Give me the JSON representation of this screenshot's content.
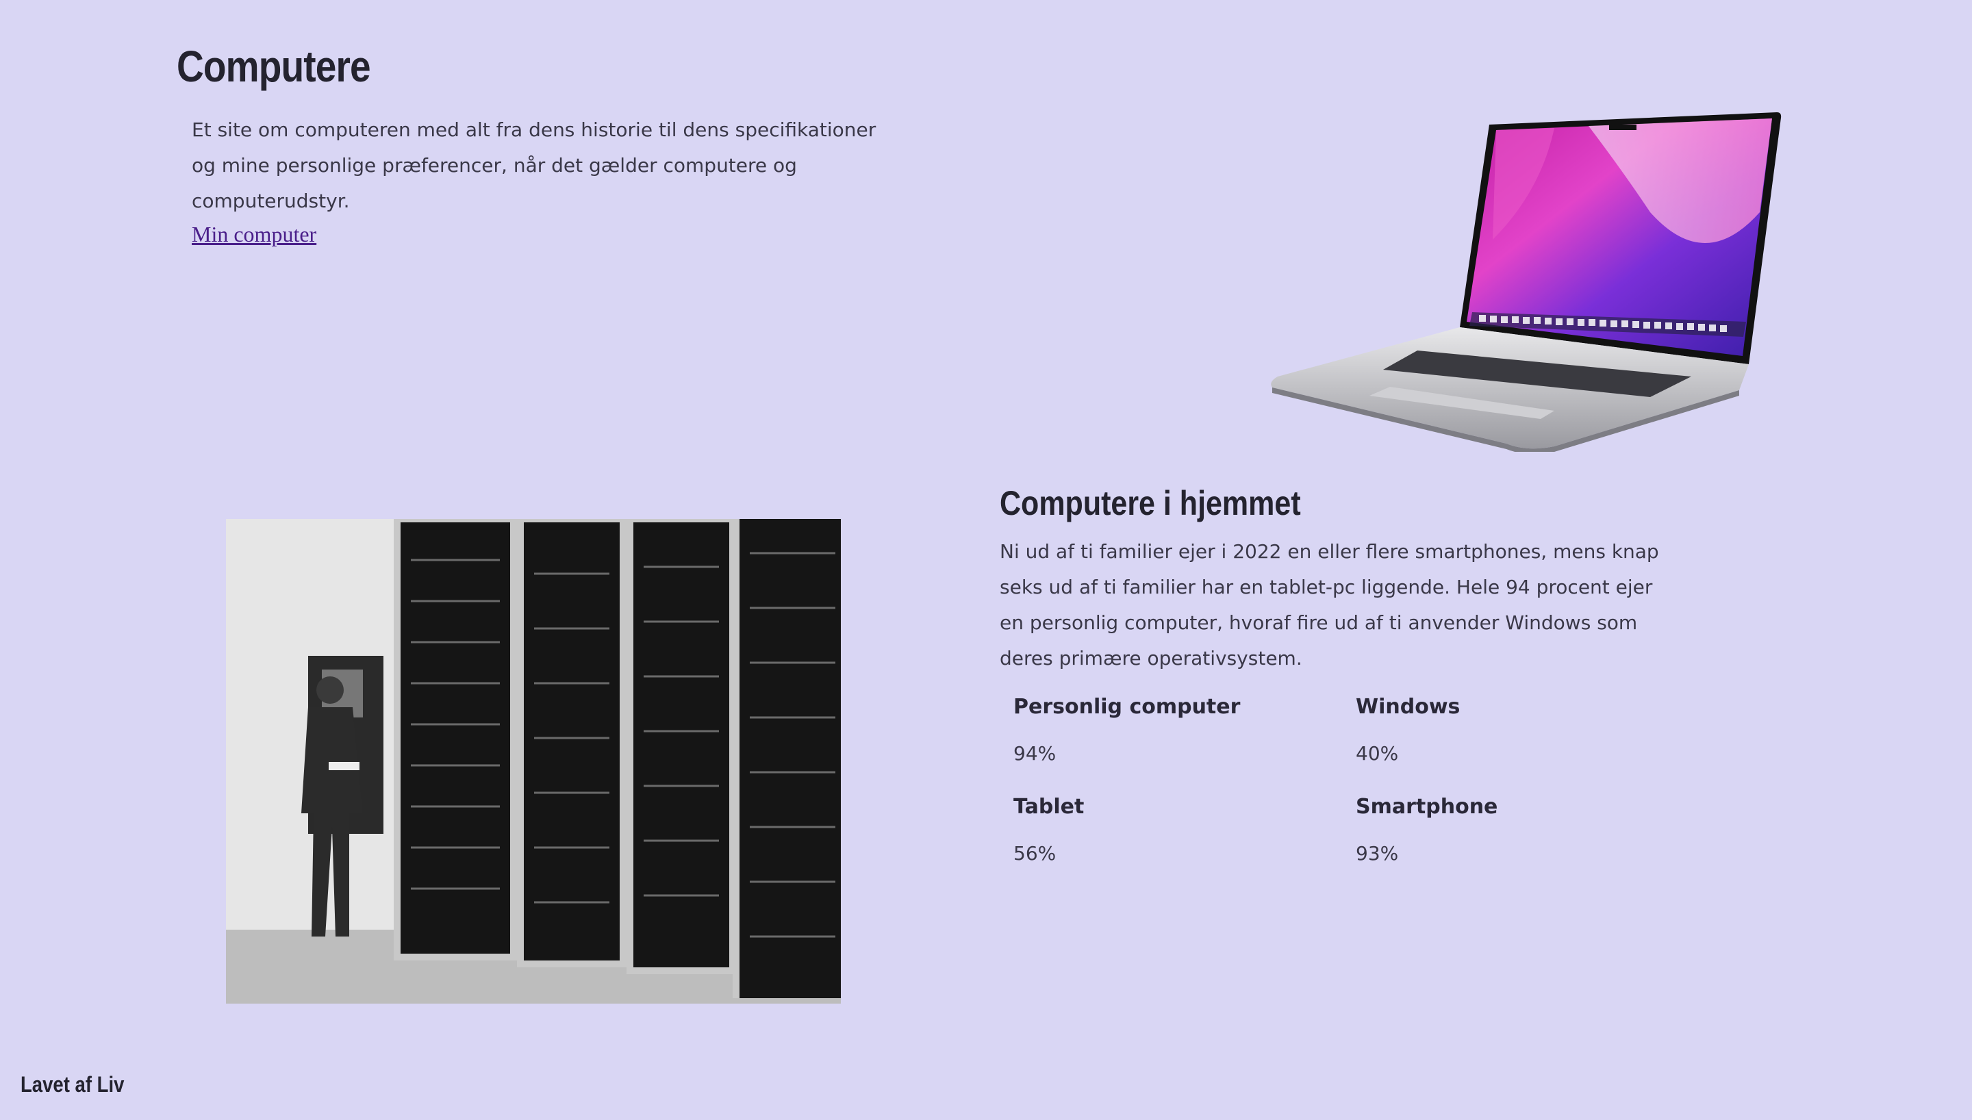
{
  "hero": {
    "title": "Computere",
    "description": "Et site om computeren med alt fra dens historie til dens specifikationer og mine personlige præferencer, når det gælder computere og computerudstyr.",
    "link_label": "Min computer"
  },
  "home_section": {
    "title": "Computere i hjemmet",
    "description": "Ni ud af ti familier ejer i 2022 en eller flere smartphones, mens knap seks ud af ti familier har en tablet-pc liggende. Hele 94 procent ejer en personlig computer, hvoraf fire ud af ti anvender Windows som deres primære operativsystem.",
    "stats": [
      {
        "label": "Personlig computer",
        "value": "94%"
      },
      {
        "label": "Windows",
        "value": "40%"
      },
      {
        "label": "Tablet",
        "value": "56%"
      },
      {
        "label": "Smartphone",
        "value": "93%"
      }
    ]
  },
  "footer": {
    "credit": "Lavet af Liv"
  },
  "colors": {
    "background": "#d9d6f4",
    "text": "#2a2838",
    "link": "#4a1f8a"
  }
}
